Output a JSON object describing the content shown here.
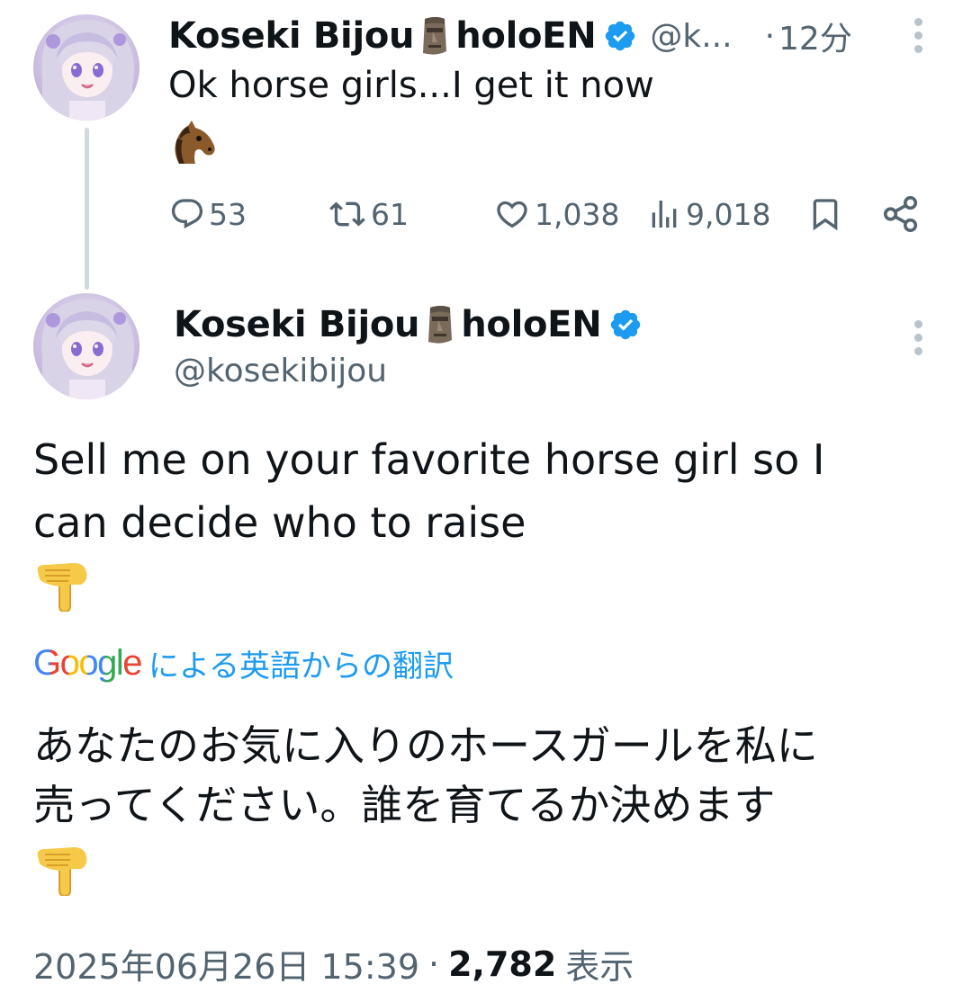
{
  "reply": {
    "display_name": "Koseki Bijou",
    "name_emoji": "moai",
    "name_suffix": "holoEN",
    "handle_truncated": "@k...",
    "time_sep": "·",
    "time": "12分",
    "text": "Ok horse girls...I get it now",
    "emoji": "horse-face",
    "actions": {
      "replies": "53",
      "retweets": "61",
      "likes": "1,038",
      "views": "9,018"
    }
  },
  "main": {
    "display_name": "Koseki Bijou",
    "name_emoji": "moai",
    "name_suffix": "holoEN",
    "handle": "@kosekibijou",
    "text_line1": "Sell me on your favorite horse girl so I",
    "text_line2": "can decide who to raise",
    "emoji": "backhand-index-pointing-down",
    "translation": {
      "provider": "Google",
      "label": "による英語からの翻訳",
      "line1": "あなたのお気に入りのホースガールを私に",
      "line2": "売ってください。誰を育てるか決めます"
    },
    "timestamp": "2025年06月26日 15:39",
    "sep": "·",
    "views_count": "2,782",
    "views_label": "表示"
  },
  "colors": {
    "text": "#0f1419",
    "secondary": "#536471",
    "link": "#1d9bf0",
    "verified": "#1d9bf0",
    "thread_line": "#cfd9de"
  }
}
